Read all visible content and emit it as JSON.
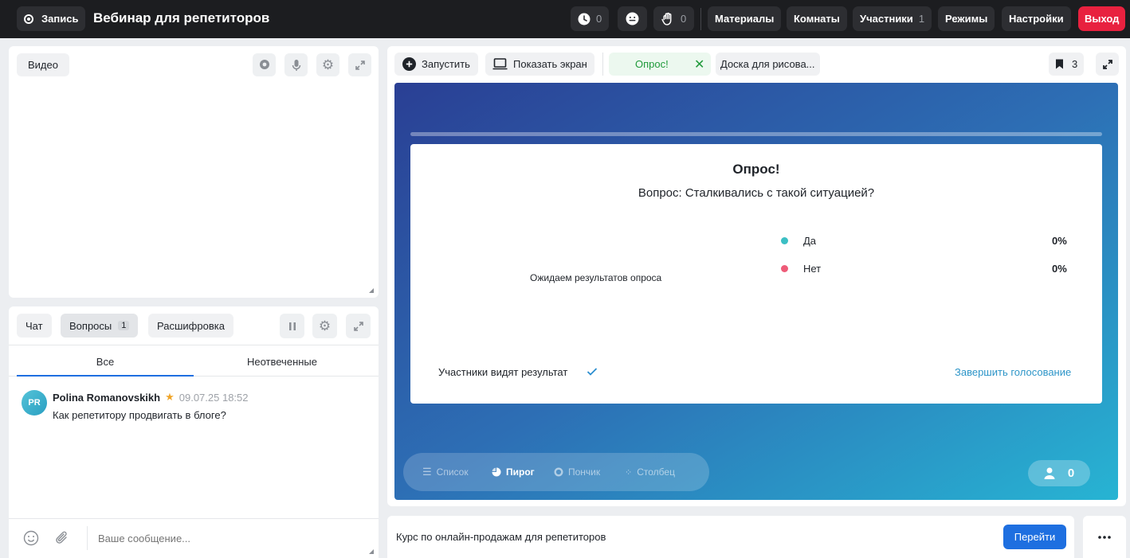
{
  "topbar": {
    "record_label": "Запись",
    "title": "Вебинар для репетиторов",
    "timer_count": "0",
    "reactions_count": "0",
    "hands_count": "0",
    "materials": "Материалы",
    "rooms": "Комнаты",
    "participants": "Участники",
    "participants_count": "1",
    "modes": "Режимы",
    "settings": "Настройки",
    "exit": "Выход"
  },
  "video_panel": {
    "label": "Видео"
  },
  "chat_panel": {
    "tabs": [
      {
        "label": "Чат"
      },
      {
        "label": "Вопросы",
        "count": "1"
      },
      {
        "label": "Расшифровка"
      }
    ],
    "sub_tabs": [
      "Все",
      "Неотвеченные"
    ],
    "messages": [
      {
        "initials": "PR",
        "author": "Polina Romanovskikh",
        "timestamp": "09.07.25 18:52",
        "text": "Как репетитору продвигать в блоге?"
      }
    ],
    "input_placeholder": "Ваше сообщение..."
  },
  "stage_toolbar": {
    "launch": "Запустить",
    "share_screen": "Показать экран",
    "active_tab": "Опрос!",
    "board_tab": "Доска для рисова...",
    "bookmarks_count": "3"
  },
  "poll": {
    "title": "Опрос!",
    "question": "Вопрос: Сталкивались с такой ситуацией?",
    "waiting_text": "Ожидаем результатов опроса",
    "options": [
      {
        "label": "Да",
        "percent": "0%",
        "color": "#3bbfc4"
      },
      {
        "label": "Нет",
        "percent": "0%",
        "color": "#ee5b78"
      }
    ],
    "participants_see": "Участники видят результат",
    "finish": "Завершить голосование"
  },
  "view_modes": [
    {
      "label": "Список",
      "icon": "list-icon"
    },
    {
      "label": "Пирог",
      "icon": "pie-icon",
      "active": true
    },
    {
      "label": "Пончик",
      "icon": "donut-icon"
    },
    {
      "label": "Столбец",
      "icon": "scatter-icon"
    }
  ],
  "viewers_count": "0",
  "course_bar": {
    "text": "Курс по онлайн-продажам для репетиторов",
    "button": "Перейти"
  },
  "colors": {
    "accent": "#1e6fe0",
    "exit": "#e8213f",
    "active_tab_text": "#1f9a3a"
  }
}
